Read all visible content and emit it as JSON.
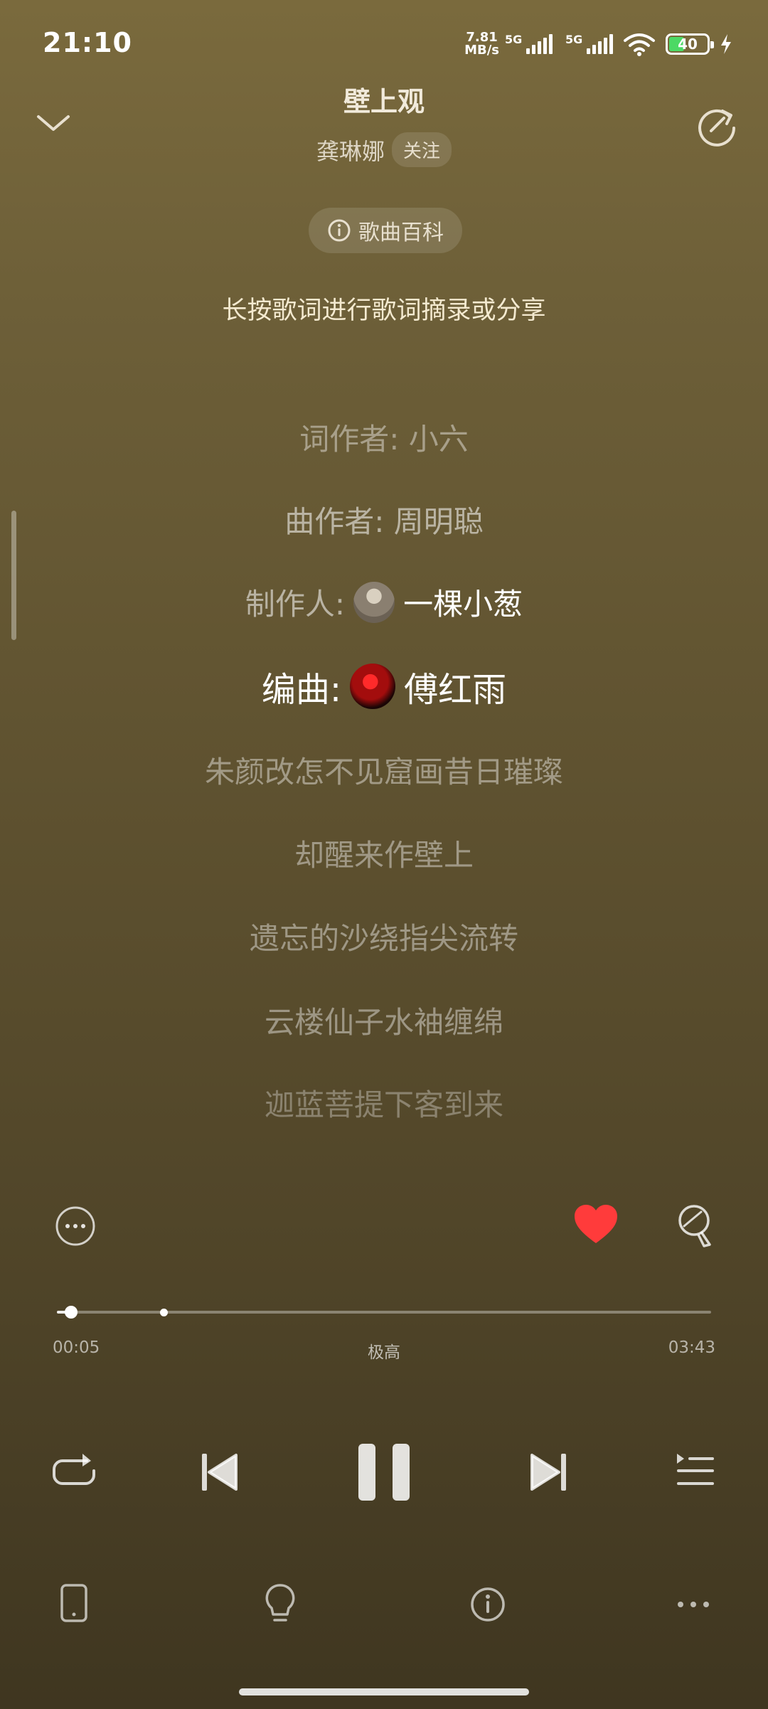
{
  "status_bar": {
    "time": "21:10",
    "net_speed_value": "7.81",
    "net_speed_unit": "MB/s",
    "sim1_label": "5G",
    "sim2_label": "5G",
    "battery_level": "40",
    "battery_fill_fraction": 0.4
  },
  "header": {
    "title": "壁上观",
    "artist": "龚琳娜",
    "follow_label": "关注",
    "collapse_icon": "chevron-down-icon",
    "refresh_icon": "share-refresh-icon"
  },
  "wiki": {
    "label": "歌曲百科",
    "icon": "info-icon"
  },
  "hint": "长按歌词进行歌词摘录或分享",
  "lyrics": {
    "lyricist": "词作者: 小六",
    "composer": "曲作者: 周明聪",
    "producer_prefix": "制作人:",
    "producer_name": "一棵小葱",
    "arranger_prefix": "编曲:",
    "arranger_name": "傅红雨",
    "lines": [
      "朱颜改怎不见窟画昔日璀璨",
      "却醒来作壁上",
      "遗忘的沙绕指尖流转",
      "云楼仙子水袖缠绵",
      "迦蓝菩提下客到来"
    ]
  },
  "actions": {
    "more_icon": "more-circle-icon",
    "like_icon": "heart-icon",
    "like_color": "#ff3b3b",
    "comment_icon": "comment-icon"
  },
  "progress": {
    "current_time": "00:05",
    "total_time": "03:43",
    "quality": "极高",
    "played_fraction": 0.022,
    "buffered_fraction": 0.163
  },
  "controls": {
    "repeat_icon": "repeat-icon",
    "prev_icon": "skip-previous-icon",
    "pause_icon": "pause-icon",
    "next_icon": "skip-next-icon",
    "playlist_icon": "playlist-icon"
  },
  "toolbar": {
    "device_icon": "phone-device-icon",
    "idea_icon": "lightbulb-icon",
    "info_icon": "info-icon",
    "more_icon": "more-dots-icon"
  }
}
